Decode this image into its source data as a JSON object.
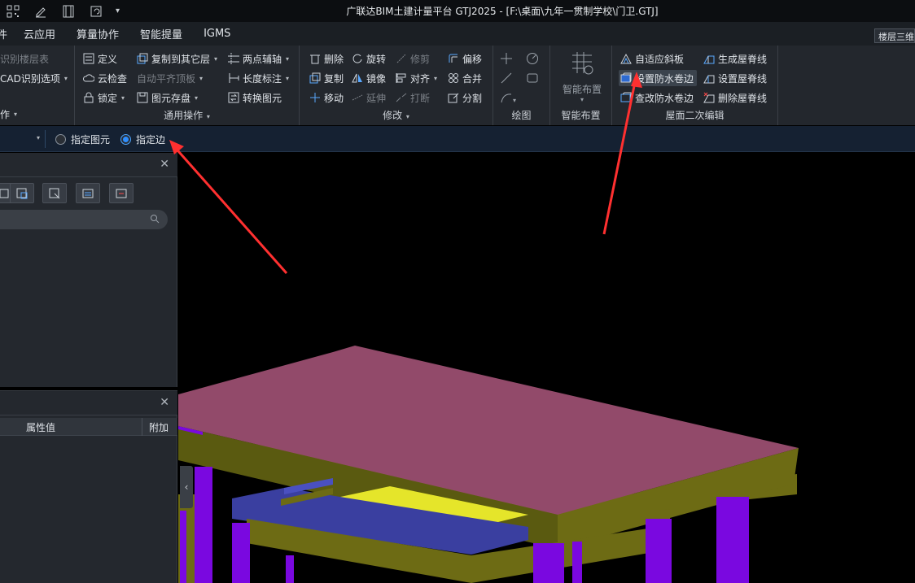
{
  "window_title": "广联达BIM土建计量平台 GTJ2025 - [F:\\桌面\\九年一贯制学校\\门卫.GTJ]",
  "menu_tabs": [
    "件",
    "云应用",
    "算量协作",
    "智能提量",
    "IGMS"
  ],
  "floor_tab": "楼层三维",
  "ribbon": {
    "g1": {
      "item1": "识别楼层表",
      "item2": "CAD识别选项",
      "label": "作"
    },
    "g2": {
      "define": "定义",
      "copy_to": "复制到其它层",
      "two_point": "两点辅轴",
      "cloud_check": "云检查",
      "auto_align": "自动平齐顶板",
      "length_mark": "长度标注",
      "lock": "锁定",
      "save_element": "图元存盘",
      "convert": "转换图元",
      "label": "通用操作"
    },
    "g3": {
      "delete": "删除",
      "rotate": "旋转",
      "trim": "修剪",
      "offset": "偏移",
      "copy": "复制",
      "mirror": "镜像",
      "align": "对齐",
      "merge": "合并",
      "move": "移动",
      "extend": "延伸",
      "break": "打断",
      "split": "分割",
      "label": "修改"
    },
    "g4": {
      "label": "绘图"
    },
    "g5": {
      "button": "智能布置",
      "label": "智能布置"
    },
    "g6": {
      "adaptive_slope": "自适应斜板",
      "gen_ridge": "生成屋脊线",
      "set_waterproof": "设置防水卷边",
      "set_ridge": "设置屋脊线",
      "check_waterproof": "查改防水卷边",
      "del_ridge": "删除屋脊线",
      "label": "屋面二次编辑"
    }
  },
  "subbar": {
    "opt1": "指定图元",
    "opt2": "指定边",
    "selected": "指定边"
  },
  "props": {
    "col_value": "属性值",
    "col_extra": "附加"
  },
  "colors": {
    "roof": "#924a6a",
    "beam": "#6d6b14",
    "column": "#7a08e0",
    "blue_beam": "#3a3fa0",
    "yellow": "#e5e52a",
    "arrow": "#ff3030",
    "accent": "#2f8fff"
  }
}
